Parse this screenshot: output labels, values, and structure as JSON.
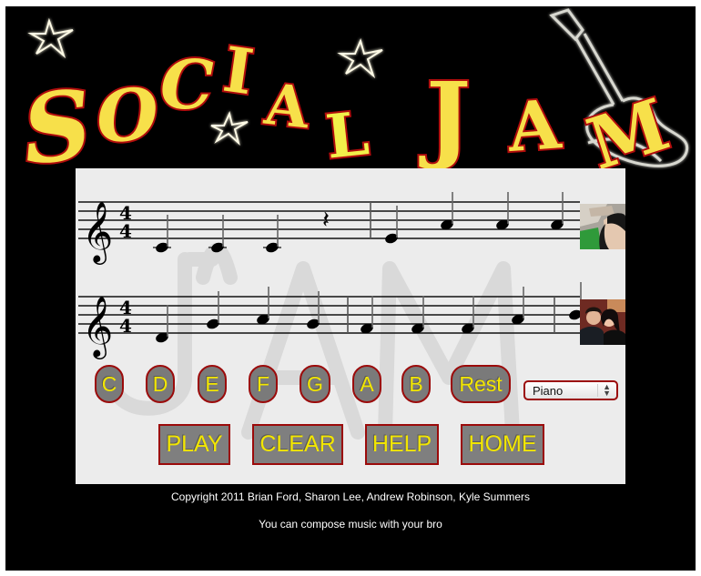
{
  "app": {
    "title_word1": "SOCIAL",
    "title_word2": "JAM",
    "logo_letters": [
      "S",
      "O",
      "C",
      "I",
      "A",
      "L",
      "J",
      "A",
      "M"
    ]
  },
  "score": {
    "clef": "treble",
    "time_signature": {
      "top": "4",
      "bottom": "4"
    },
    "staves": [
      {
        "user": "user-1",
        "measures": [
          [
            "C4",
            "C4",
            "C4",
            "rest"
          ],
          [
            "E4",
            "A4",
            "A4",
            "A4"
          ]
        ]
      },
      {
        "user": "user-2",
        "measures": [
          [
            "D4",
            "G4",
            "A4",
            "G4"
          ],
          [
            "F4",
            "F4",
            "F4",
            "A4"
          ],
          [
            "B4"
          ]
        ]
      }
    ]
  },
  "note_buttons": [
    "C",
    "D",
    "E",
    "F",
    "G",
    "A",
    "B",
    "Rest"
  ],
  "instrument_select": {
    "selected": "Piano"
  },
  "action_buttons": [
    "PLAY",
    "CLEAR",
    "HELP",
    "HOME"
  ],
  "footer": {
    "copyright": "Copyright 2011 Brian Ford, Sharon Lee, Andrew Robinson, Kyle Summers",
    "tagline": "You can compose music with your bro"
  },
  "colors": {
    "background": "#000000",
    "panel": "#ececec",
    "logo_fill": "#f7e04a",
    "logo_outline": "#b00c0c",
    "button_fill": "#7a7a7a",
    "button_text": "#f2e600",
    "button_border": "#9b0a0a"
  }
}
